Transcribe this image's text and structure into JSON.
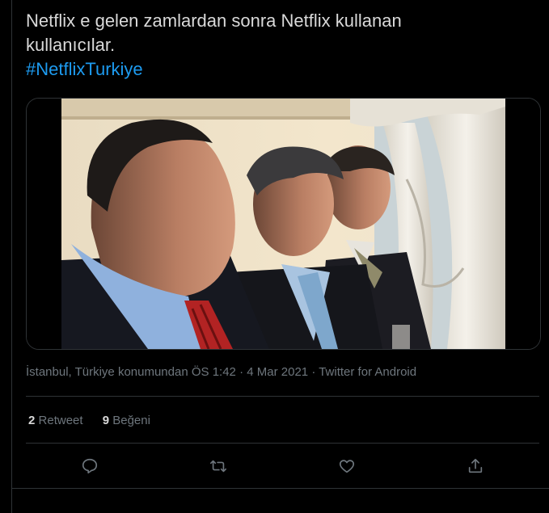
{
  "tweet": {
    "text_line1": "Netflix e gelen zamlardan sonra Netflix kullanan",
    "text_line2": "kullanıcılar.",
    "hashtag": "#NetflixTurkiye"
  },
  "meta": {
    "location": "İstanbul, Türkiye konumundan",
    "time": "ÖS 1:42",
    "separator": "·",
    "date": "4 Mar 2021",
    "source": "Twitter for Android"
  },
  "stats": {
    "retweets_count": "2",
    "retweets_label": "Retweet",
    "likes_count": "9",
    "likes_label": "Beğeni"
  },
  "actions": {
    "reply_icon": "reply-icon",
    "retweet_icon": "retweet-icon",
    "like_icon": "heart-icon",
    "share_icon": "share-icon"
  },
  "colors": {
    "background": "#000000",
    "text": "#d9d9d9",
    "muted": "#6e767d",
    "link": "#1d9bf0",
    "border": "#2f3336"
  }
}
